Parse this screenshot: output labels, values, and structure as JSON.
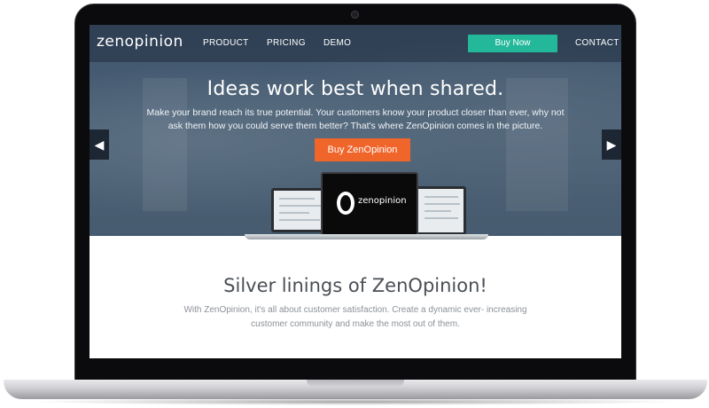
{
  "nav": {
    "logo": "zenopinion",
    "links": [
      "PRODUCT",
      "PRICING",
      "DEMO"
    ],
    "buy_now": "Buy Now",
    "contact": "CONTACT"
  },
  "hero": {
    "title": "Ideas work best when shared.",
    "text": "Make your brand reach its true potential. Your customers know your product closer than ever, why not ask them how you could serve them better? That's where ZenOpinion comes in the picture.",
    "cta": "Buy ZenOpinion",
    "device_brand": "zenopinion",
    "prev_arrow": "◀",
    "next_arrow": "▶"
  },
  "section": {
    "title": "Silver linings of ZenOpinion!",
    "text": "With ZenOpinion, it's all about customer satisfaction. Create a dynamic ever- increasing customer community and make the most out of them."
  },
  "colors": {
    "accent_green": "#22b899",
    "accent_orange": "#f0652a",
    "nav_bg": "#223042"
  }
}
